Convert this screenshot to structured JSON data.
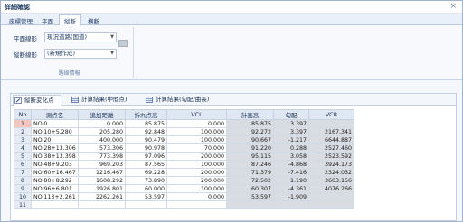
{
  "window": {
    "title": "詳細確認",
    "close_glyph": "×"
  },
  "tabs": [
    {
      "label": "座標管理"
    },
    {
      "label": "平面"
    },
    {
      "label": "縦断"
    },
    {
      "label": "横断"
    }
  ],
  "ribbon": {
    "plane_label": "平面線形",
    "plane_value": "現況道路(国道)",
    "profile_label": "縦断線形",
    "profile_value": "(新規作成)",
    "group_caption": "路線情報"
  },
  "subtabs": [
    {
      "label": "縦断変化点"
    },
    {
      "label": "計算結果(中間点)"
    },
    {
      "label": "計算結果(勾配/曲長)"
    }
  ],
  "table": {
    "headers": [
      "No",
      "測点名",
      "追加距離",
      "折れ点高",
      "VCL",
      "計画高",
      "勾配",
      "VCR"
    ],
    "rows": [
      {
        "no": "1",
        "name": "NO.0",
        "dist": "0.000",
        "elev": "85.875",
        "vcl": "0.000",
        "plan": "85.875",
        "grade": "3.397",
        "vcr": ""
      },
      {
        "no": "2",
        "name": "NO.10+5.280",
        "dist": "205.280",
        "elev": "92.848",
        "vcl": "100.000",
        "plan": "92.272",
        "grade": "3.397",
        "vcr": "2167.341"
      },
      {
        "no": "3",
        "name": "NO.20",
        "dist": "400.000",
        "elev": "90.479",
        "vcl": "100.000",
        "plan": "90.667",
        "grade": "-1.217",
        "vcr": "6644.887"
      },
      {
        "no": "4",
        "name": "NO.28+13.306",
        "dist": "573.306",
        "elev": "90.978",
        "vcl": "70.000",
        "plan": "91.220",
        "grade": "0.288",
        "vcr": "2527.460"
      },
      {
        "no": "5",
        "name": "NO.38+13.398",
        "dist": "773.398",
        "elev": "97.096",
        "vcl": "200.000",
        "plan": "95.115",
        "grade": "3.058",
        "vcr": "2523.592"
      },
      {
        "no": "6",
        "name": "NO.48+9.203",
        "dist": "969.203",
        "elev": "87.565",
        "vcl": "100.000",
        "plan": "87.246",
        "grade": "-4.868",
        "vcr": "3924.173"
      },
      {
        "no": "7",
        "name": "NO.60+16.467",
        "dist": "1216.467",
        "elev": "69.228",
        "vcl": "200.000",
        "plan": "71.379",
        "grade": "-7.416",
        "vcr": "2324.032"
      },
      {
        "no": "8",
        "name": "NO.80+8.292",
        "dist": "1608.292",
        "elev": "73.890",
        "vcl": "200.000",
        "plan": "72.502",
        "grade": "1.190",
        "vcr": "3603.156"
      },
      {
        "no": "9",
        "name": "NO.96+6.801",
        "dist": "1926.801",
        "elev": "60.000",
        "vcl": "100.000",
        "plan": "60.307",
        "grade": "-4.361",
        "vcr": "4076.266"
      },
      {
        "no": "10",
        "name": "NO.113+2.261",
        "dist": "2262.261",
        "elev": "53.597",
        "vcl": "0.000",
        "plan": "53.597",
        "grade": "-1.909",
        "vcr": ""
      },
      {
        "no": "11",
        "name": "",
        "dist": "",
        "elev": "",
        "vcl": "",
        "plan": "",
        "grade": "",
        "vcr": ""
      }
    ]
  },
  "colors": {
    "selected_row_marker": "#f2c7bf",
    "readonly_cell": "#d9dde3",
    "header_bg": "#dfe7f3"
  }
}
